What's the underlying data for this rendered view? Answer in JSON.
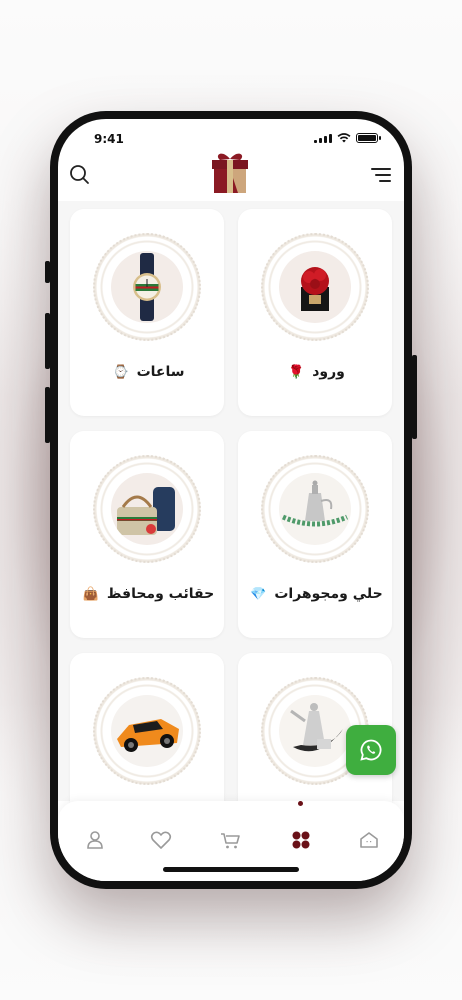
{
  "status_bar": {
    "time": "9:41"
  },
  "header": {
    "search_icon": "search-icon",
    "menu_icon": "menu-icon",
    "logo": "gift-box-logo"
  },
  "categories": [
    {
      "label": "ورود",
      "emoji": "🌹"
    },
    {
      "label": "ساعات",
      "emoji": "⌚"
    },
    {
      "label": "حلي ومجوهرات",
      "emoji": "💎"
    },
    {
      "label": "حقائب ومحافظ",
      "emoji": "👜"
    },
    {
      "label": "",
      "emoji": ""
    },
    {
      "label": "",
      "emoji": ""
    }
  ],
  "floating": {
    "whatsapp_icon": "whatsapp-icon"
  },
  "bottom_nav": {
    "items": [
      "home-icon",
      "categories-icon",
      "cart-icon",
      "wishlist-icon",
      "profile-icon"
    ],
    "active": "categories-icon"
  },
  "colors": {
    "brand": "#6a1118",
    "accent_gold": "#c9a66b",
    "whatsapp": "#3fae3f"
  }
}
